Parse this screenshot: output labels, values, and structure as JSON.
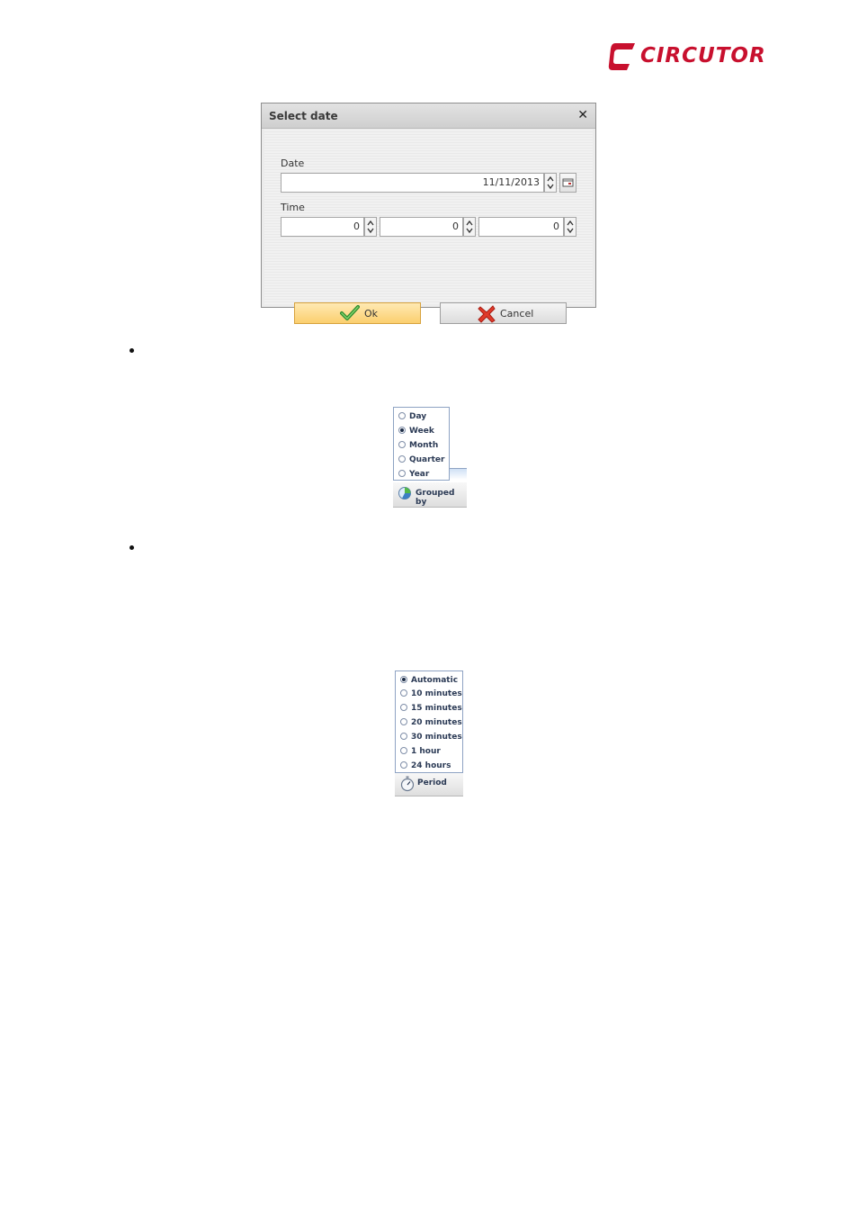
{
  "logo": {
    "text": "CIRCUTOR",
    "color": "#c8102e"
  },
  "dialog": {
    "title": "Select date",
    "date_label": "Date",
    "date_value": "11/11/2013",
    "time_label": "Time",
    "time_values": [
      "0",
      "0",
      "0"
    ],
    "ok_label": "Ok",
    "cancel_label": "Cancel"
  },
  "grouped_by": {
    "options": [
      "Day",
      "Week",
      "Month",
      "Quarter",
      "Year"
    ],
    "selected": "Week",
    "button_label": "Grouped by"
  },
  "period": {
    "options": [
      "Automatic",
      "10 minutes",
      "15 minutes",
      "20 minutes",
      "30 minutes",
      "1 hour",
      "24 hours"
    ],
    "selected": "Automatic",
    "button_label": "Period"
  },
  "colors": {
    "accent": "#c8102e",
    "ok_button": "#fbcf6e",
    "popup_border": "#8ea3c3"
  }
}
